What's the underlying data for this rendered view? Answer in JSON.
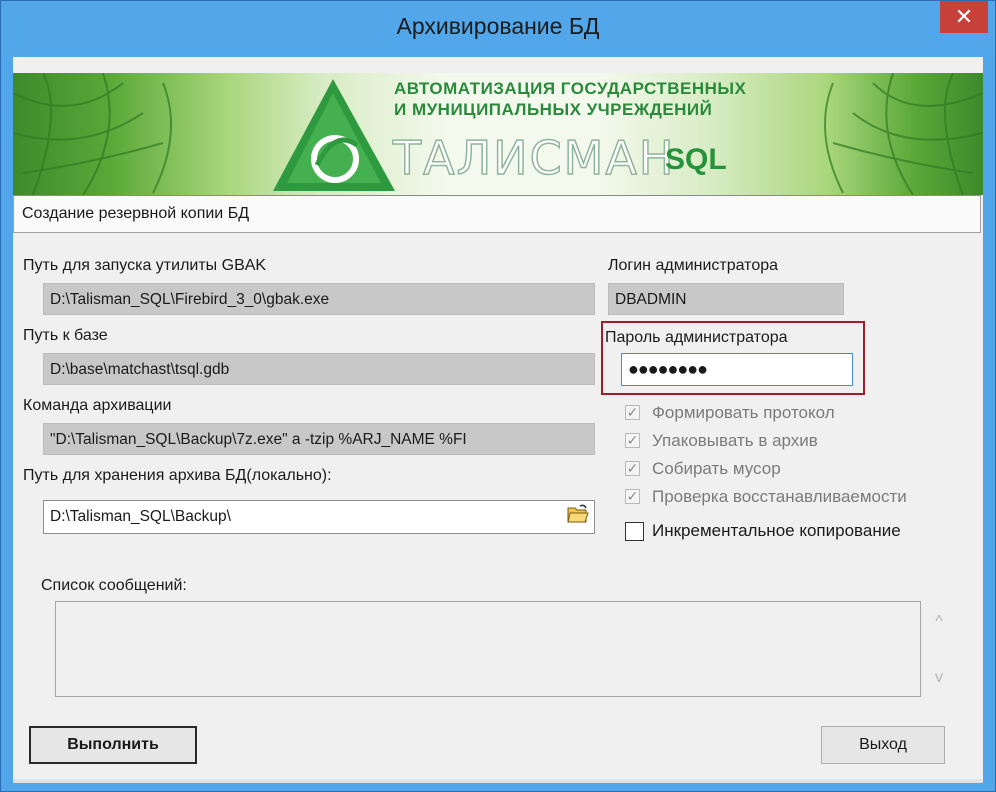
{
  "window": {
    "title": "Архивирование БД",
    "close_glyph": "✕"
  },
  "banner": {
    "line1": "АВТОМАТИЗАЦИЯ ГОСУДАРСТВЕННЫХ",
    "line2": "И МУНИЦИПАЛЬНЫХ УЧРЕЖДЕНИЙ",
    "brand": "ТАЛИСМАН",
    "brand_suffix": "SQL",
    "logo_icon": "green-triangle-logo-icon"
  },
  "header": {
    "description": "Создание резервной копии БД"
  },
  "form": {
    "gbak_label": "Путь для запуска утилиты GBAK",
    "gbak_value": "D:\\Talisman_SQL\\Firebird_3_0\\gbak.exe",
    "db_label": "Путь к базе",
    "db_value": "D:\\base\\matchast\\tsql.gdb",
    "cmd_label": "Команда архивации",
    "cmd_value": "\"D:\\Talisman_SQL\\Backup\\7z.exe\" a -tzip %ARJ_NAME %FI",
    "storage_label": "Путь для хранения архива БД(локально):",
    "storage_value": "D:\\Talisman_SQL\\Backup\\",
    "folder_icon": "folder-open-icon",
    "login_label": "Логин администратора",
    "login_value": "DBADMIN",
    "password_label": "Пароль администратора",
    "password_value": "●●●●●●●●"
  },
  "checkboxes": [
    {
      "label": "Формировать протокол",
      "checked": true,
      "enabled": false
    },
    {
      "label": "Упаковывать в архив",
      "checked": true,
      "enabled": false
    },
    {
      "label": "Собирать мусор",
      "checked": true,
      "enabled": false
    },
    {
      "label": "Проверка восстанавливаемости",
      "checked": true,
      "enabled": false
    },
    {
      "label": "Инкрементальное копирование",
      "checked": false,
      "enabled": true
    }
  ],
  "messages": {
    "label": "Список сообщений:",
    "scroll_up_glyph": "^",
    "scroll_down_glyph": "v"
  },
  "buttons": {
    "run_label": "Выполнить",
    "exit_label": "Выход"
  },
  "colors": {
    "titlebar": "#52a7ea",
    "close": "#c7403a",
    "highlight": "#a01e2b",
    "brand_green": "#2a8a3c"
  }
}
